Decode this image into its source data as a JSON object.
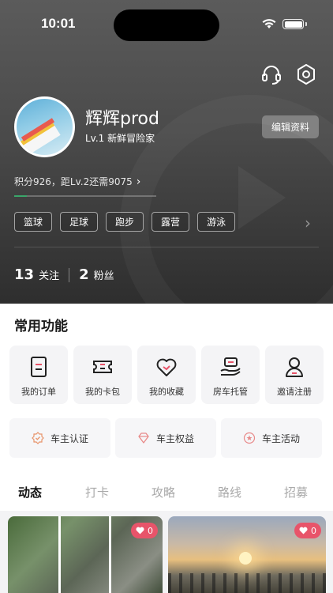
{
  "status_bar": {
    "time": "10:01"
  },
  "header": {
    "icons": [
      "headset-icon",
      "settings-hexagon-icon"
    ]
  },
  "profile": {
    "username": "辉辉prod",
    "level_text": "Lv.1 新鲜冒险家",
    "edit_label": "编辑资料",
    "points_text": "积分926，距Lv.2还需9075",
    "progress": 0.09,
    "progress_color": "#3aa66a"
  },
  "tags": [
    "篮球",
    "足球",
    "跑步",
    "露营",
    "游泳"
  ],
  "stats": {
    "following_count": "13",
    "following_label": "关注",
    "followers_count": "2",
    "followers_label": "粉丝"
  },
  "common_functions": {
    "title": "常用功能",
    "items": [
      {
        "label": "我的订单",
        "icon": "order-icon"
      },
      {
        "label": "我的卡包",
        "icon": "ticket-icon"
      },
      {
        "label": "我的收藏",
        "icon": "heart-icon"
      },
      {
        "label": "房车托管",
        "icon": "hand-care-icon"
      },
      {
        "label": "邀请注册",
        "icon": "invite-user-icon"
      }
    ]
  },
  "owner_features": [
    {
      "label": "车主认证",
      "icon": "verify-badge-icon"
    },
    {
      "label": "车主权益",
      "icon": "diamond-icon"
    },
    {
      "label": "车主活动",
      "icon": "star-badge-icon"
    }
  ],
  "tabs": [
    "动态",
    "打卡",
    "攻略",
    "路线",
    "招募"
  ],
  "active_tab": "动态",
  "feed": [
    {
      "likes": "0"
    },
    {
      "likes": "0"
    }
  ],
  "accent_color": "#e8546a"
}
